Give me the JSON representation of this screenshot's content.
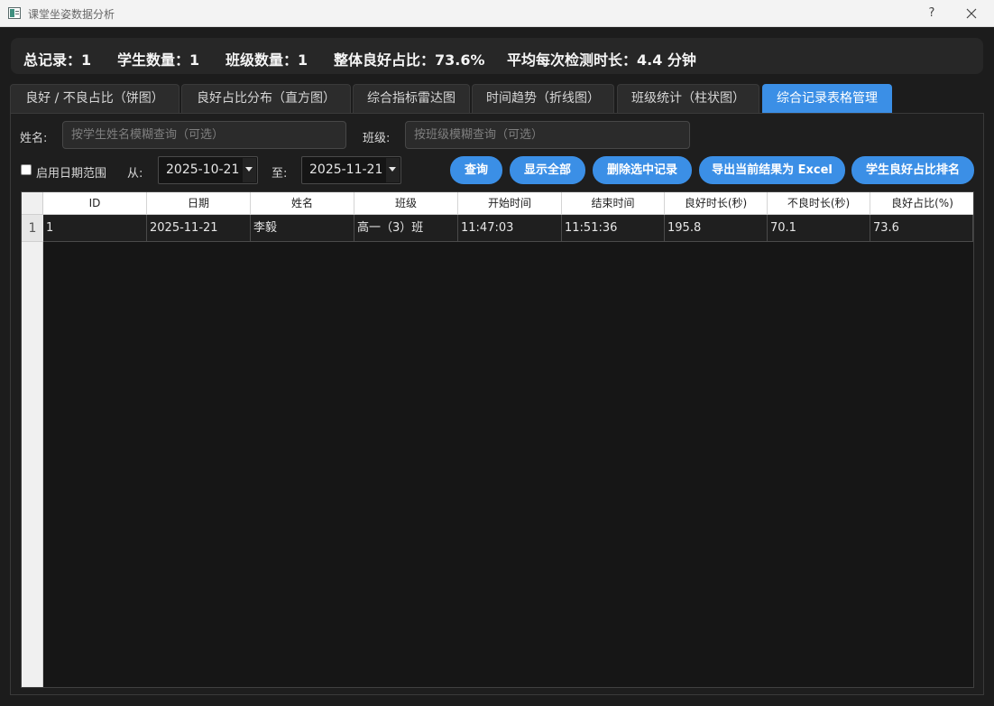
{
  "window": {
    "title": "课堂坐姿数据分析",
    "help": "?"
  },
  "stats": {
    "total_records": "总记录：1",
    "student_count": "学生数量：1",
    "class_count": "班级数量：1",
    "good_ratio": "整体良好占比：73.6%",
    "avg_duration": "平均每次检测时长：4.4 分钟"
  },
  "tabs": [
    {
      "label": "良好 / 不良占比（饼图）"
    },
    {
      "label": "良好占比分布（直方图）"
    },
    {
      "label": "综合指标雷达图"
    },
    {
      "label": "时间趋势（折线图）"
    },
    {
      "label": "班级统计（柱状图）"
    },
    {
      "label": "综合记录表格管理"
    }
  ],
  "active_tab": 5,
  "filters": {
    "name_label": "姓名:",
    "name_placeholder": "按学生姓名模糊查询（可选）",
    "class_label": "班级:",
    "class_placeholder": "按班级模糊查询（可选）",
    "date_range_label": "启用日期范围",
    "from_label": "从:",
    "from_value": "2025-10-21",
    "to_label": "至:",
    "to_value": "2025-11-21"
  },
  "buttons": {
    "query": "查询",
    "show_all": "显示全部",
    "delete_selected": "删除选中记录",
    "export_excel": "导出当前结果为 Excel",
    "ranking": "学生良好占比排名"
  },
  "table": {
    "columns": [
      "ID",
      "日期",
      "姓名",
      "班级",
      "开始时间",
      "结束时间",
      "良好时长(秒)",
      "不良时长(秒)",
      "良好占比(%)"
    ],
    "rows": [
      {
        "row_number": "1",
        "cells": [
          "1",
          "2025-11-21",
          "李毅",
          "高一（3）班",
          "11:47:03",
          "11:51:36",
          "195.8",
          "70.1",
          "73.6"
        ]
      }
    ]
  },
  "colors": {
    "accent": "#3b8fe6",
    "background": "#1c1c1c",
    "panel": "#272727"
  }
}
